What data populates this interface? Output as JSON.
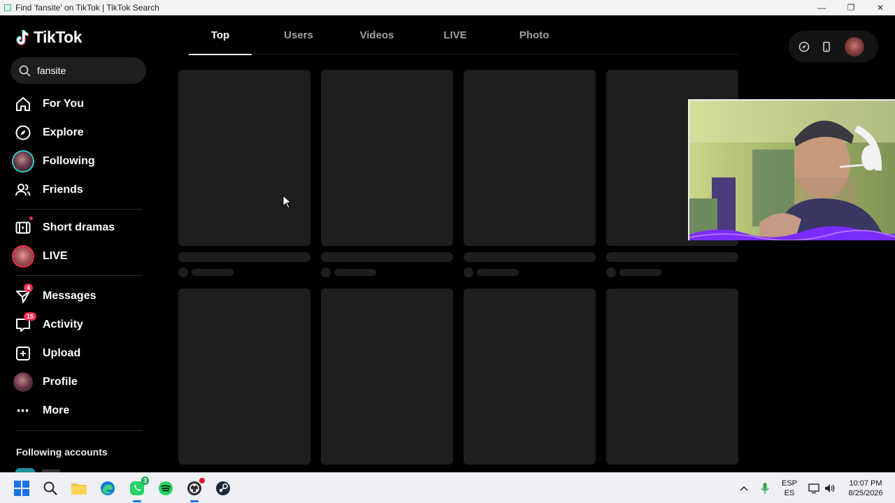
{
  "window": {
    "title": "Find 'fansite' on TikTok | TikTok Search"
  },
  "brand": {
    "name": "TikTok",
    "accent": "#fe2c55",
    "teal": "#25f4ee"
  },
  "search": {
    "value": "fansite",
    "icon": "search-icon"
  },
  "nav": {
    "for_you": "For You",
    "explore": "Explore",
    "following": "Following",
    "friends": "Friends",
    "short_dramas": "Short dramas",
    "live": "LIVE",
    "messages": "Messages",
    "messages_badge": "4",
    "activity": "Activity",
    "activity_badge": "15",
    "upload": "Upload",
    "profile": "Profile",
    "more": "More"
  },
  "following_accounts_title": "Following accounts",
  "tabs": {
    "top": "Top",
    "users": "Users",
    "videos": "Videos",
    "live": "LIVE",
    "photo": "Photo"
  },
  "taskbar": {
    "whatsapp_badge": "3",
    "lang_primary": "ESP",
    "lang_secondary": "ES",
    "time": "10:07 PM",
    "date": "8/25/2026"
  }
}
